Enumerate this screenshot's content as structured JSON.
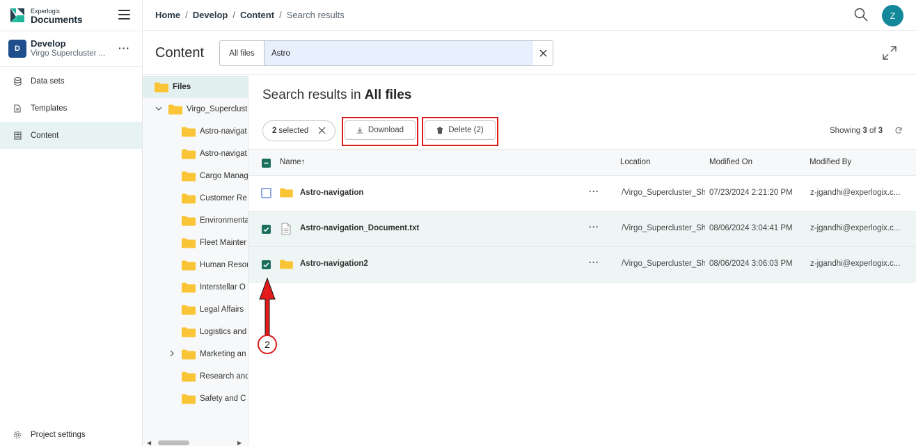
{
  "brand": {
    "top": "Experlogix",
    "bottom": "Documents"
  },
  "project": {
    "badge": "D",
    "name": "Develop",
    "subtitle": "Virgo Supercluster ..."
  },
  "nav": [
    {
      "label": "Data sets",
      "icon": "database-icon"
    },
    {
      "label": "Templates",
      "icon": "document-icon"
    },
    {
      "label": "Content",
      "icon": "archive-icon",
      "active": true
    }
  ],
  "footer": {
    "label": "Project settings",
    "icon": "gear-icon"
  },
  "breadcrumb": [
    "Home",
    "Develop",
    "Content",
    "Search results"
  ],
  "user": {
    "initial": "Z"
  },
  "content": {
    "title": "Content",
    "scope": "All files",
    "search_value": "Astro"
  },
  "tree": {
    "root": "Files",
    "parent": "Virgo_Superclust",
    "children": [
      "Astro-navigat",
      "Astro-navigat",
      "Cargo Manag",
      "Customer Re",
      "Environmenta",
      "Fleet Mainter",
      "Human Resou",
      "Interstellar O",
      "Legal Affairs",
      "Logistics and",
      "Marketing an",
      "Research and",
      "Safety and C"
    ]
  },
  "results": {
    "title_prefix": "Search results in",
    "title_scope": "All files",
    "selected_count": "2",
    "selected_label": "selected",
    "download_label": "Download",
    "delete_label": "Delete (2)",
    "showing_prefix": "Showing",
    "showing_count": "3",
    "showing_of": "of",
    "showing_total": "3"
  },
  "table": {
    "headers": {
      "name": "Name",
      "sort_arrow": "↑",
      "location": "Location",
      "modified_on": "Modified On",
      "modified_by": "Modified By"
    },
    "rows": [
      {
        "name": "Astro-navigation",
        "type": "folder",
        "location": "/Virgo_Supercluster_Sh",
        "modified_on": "07/23/2024 2:21:20 PM",
        "modified_by": "z-jgandhi@experlogix.c...",
        "checked": false
      },
      {
        "name": "Astro-navigation_Document.txt",
        "type": "file",
        "location": "/Virgo_Supercluster_Sh",
        "modified_on": "08/06/2024 3:04:41 PM",
        "modified_by": "z-jgandhi@experlogix.c...",
        "checked": true
      },
      {
        "name": "Astro-navigation2",
        "type": "folder",
        "location": "/Virgo_Supercluster_Sh",
        "modified_on": "08/06/2024 3:06:03 PM",
        "modified_by": "z-jgandhi@experlogix.c...",
        "checked": true
      }
    ]
  },
  "annotation": {
    "step": "2"
  },
  "colors": {
    "accent": "#1a6e5c",
    "highlight": "#d81b1b",
    "avatar": "#13889a"
  }
}
